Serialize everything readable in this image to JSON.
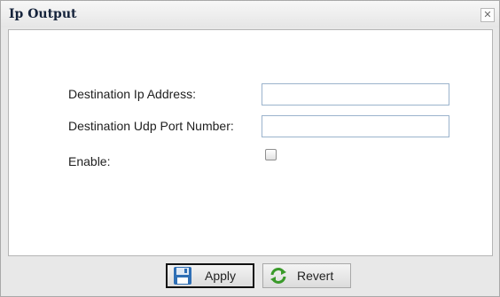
{
  "dialog": {
    "title": "Ip Output",
    "close_glyph": "✕"
  },
  "form": {
    "dest_ip_label": "Destination Ip Address:",
    "dest_ip_value": "",
    "dest_port_label": "Destination Udp Port Number:",
    "dest_port_value": "",
    "enable_label": "Enable:",
    "enable_checked": false
  },
  "buttons": {
    "apply_label": "Apply",
    "apply_icon": "floppy-disk-icon",
    "revert_label": "Revert",
    "revert_icon": "refresh-arrows-icon"
  },
  "colors": {
    "title_text": "#15233b",
    "field_border": "#9bb3cc",
    "revert_icon_green": "#3a9a2a",
    "apply_icon_blue": "#2f6fb5"
  }
}
